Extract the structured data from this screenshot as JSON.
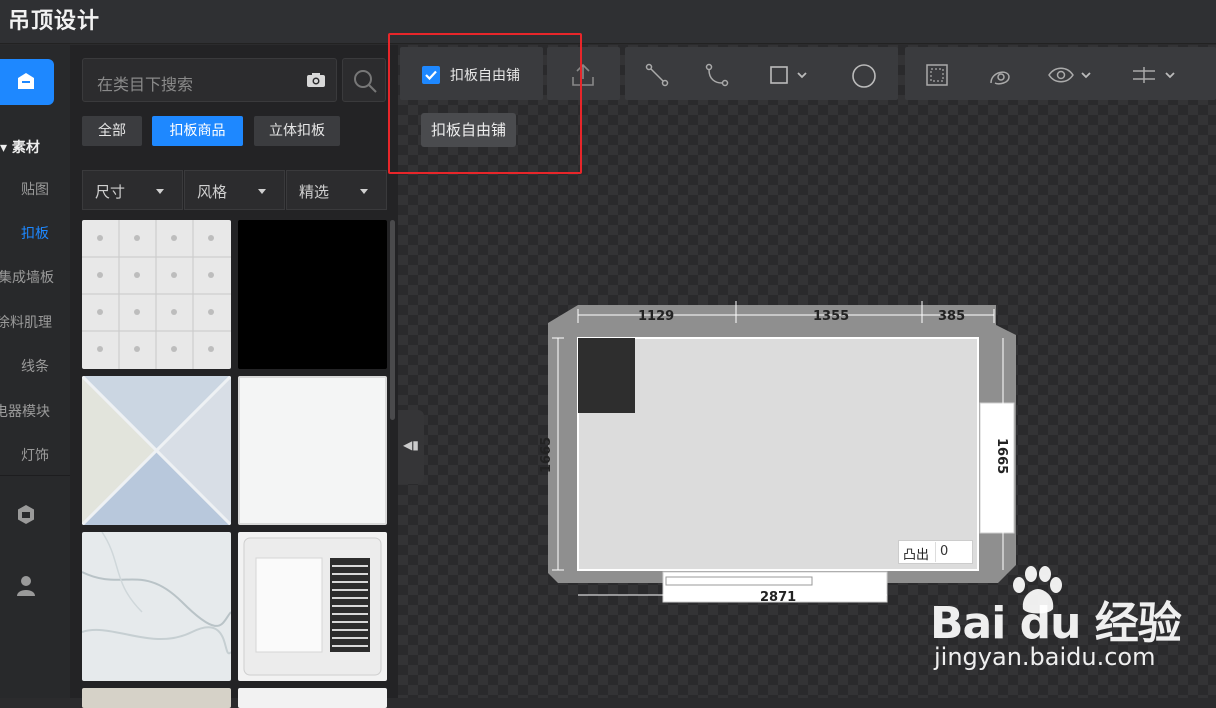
{
  "app": {
    "title": "吊顶设计"
  },
  "rail": {
    "group_label": "素材",
    "items": [
      {
        "label": "贴图",
        "active": false
      },
      {
        "label": "扣板",
        "active": true
      },
      {
        "label": "集成墙板",
        "active": false
      },
      {
        "label": "涂料肌理",
        "active": false
      },
      {
        "label": "线条",
        "active": false
      },
      {
        "label": "电器模块",
        "active": false
      },
      {
        "label": "灯饰",
        "active": false
      }
    ],
    "icons": [
      "material-home-icon",
      "package-icon",
      "user-icon"
    ]
  },
  "panel": {
    "search": {
      "placeholder": "在类目下搜索"
    },
    "tabs": [
      {
        "label": "全部",
        "active": false
      },
      {
        "label": "扣板商品",
        "active": true
      },
      {
        "label": "立体扣板",
        "active": false
      }
    ],
    "filters": [
      {
        "label": "尺寸"
      },
      {
        "label": "风格"
      },
      {
        "label": "精选"
      }
    ],
    "tiles": [
      "patterned-tile",
      "black-tile",
      "blue-triangle-tile",
      "white-tile",
      "marble-tile",
      "bath-heater-tile"
    ]
  },
  "toolbar": {
    "free_layout_label": "扣板自由铺",
    "free_layout_checked": true,
    "tooltip": "扣板自由铺",
    "tools": [
      "upload-icon",
      "line-icon",
      "arc-icon",
      "rectangle-icon",
      "circle-icon",
      "select-area-icon",
      "lasso-icon",
      "eye-icon",
      "align-icon"
    ]
  },
  "plan": {
    "dim_top": [
      "1129",
      "1355",
      "385"
    ],
    "dim_left": "1665",
    "dim_right": "1665",
    "dim_bottom": "2871",
    "bump_label": "凸出",
    "bump_value": "0"
  },
  "watermark": {
    "brand": "Bai du 经验",
    "url": "jingyan.baidu.com"
  },
  "colors": {
    "accent": "#1e88ff",
    "highlight": "#e8262a"
  }
}
